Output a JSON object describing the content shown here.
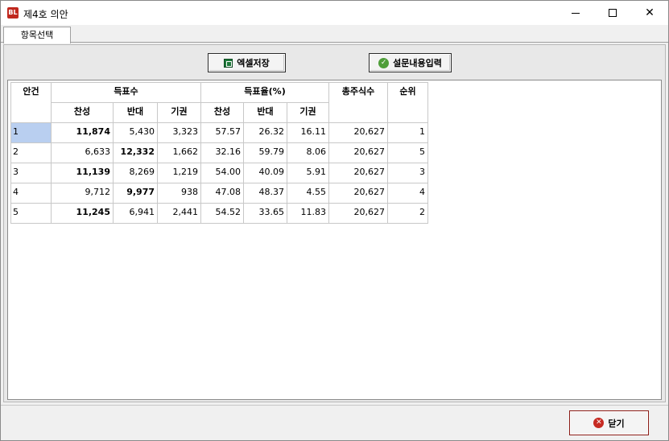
{
  "window": {
    "title": "제4호 의안",
    "app_icon_text": "BL",
    "minimize_glyph": "",
    "close_glyph": "✕"
  },
  "tabs": [
    {
      "label": "항목선택"
    }
  ],
  "toolbar": {
    "excel_save_label": "엑셀저장",
    "survey_input_label": "설문내용입력"
  },
  "grid": {
    "headers": {
      "agenda": "안건",
      "votes_group": "득표수",
      "rate_group": "득표율(%)",
      "total_shares": "총주식수",
      "rank": "순위",
      "favor": "찬성",
      "against": "반대",
      "abstain": "기권"
    },
    "rows": [
      {
        "id": "1",
        "favor": "11,874",
        "against": "5,430",
        "abstain": "3,323",
        "favor_rate": "57.57",
        "against_rate": "26.32",
        "abstain_rate": "16.11",
        "total": "20,627",
        "rank": "1",
        "bold": "favor"
      },
      {
        "id": "2",
        "favor": "6,633",
        "against": "12,332",
        "abstain": "1,662",
        "favor_rate": "32.16",
        "against_rate": "59.79",
        "abstain_rate": "8.06",
        "total": "20,627",
        "rank": "5",
        "bold": "against"
      },
      {
        "id": "3",
        "favor": "11,139",
        "against": "8,269",
        "abstain": "1,219",
        "favor_rate": "54.00",
        "against_rate": "40.09",
        "abstain_rate": "5.91",
        "total": "20,627",
        "rank": "3",
        "bold": "favor"
      },
      {
        "id": "4",
        "favor": "9,712",
        "against": "9,977",
        "abstain": "938",
        "favor_rate": "47.08",
        "against_rate": "48.37",
        "abstain_rate": "4.55",
        "total": "20,627",
        "rank": "4",
        "bold": "against"
      },
      {
        "id": "5",
        "favor": "11,245",
        "against": "6,941",
        "abstain": "2,441",
        "favor_rate": "54.52",
        "against_rate": "33.65",
        "abstain_rate": "11.83",
        "total": "20,627",
        "rank": "2",
        "bold": "favor"
      }
    ]
  },
  "footer": {
    "close_label": "닫기"
  }
}
